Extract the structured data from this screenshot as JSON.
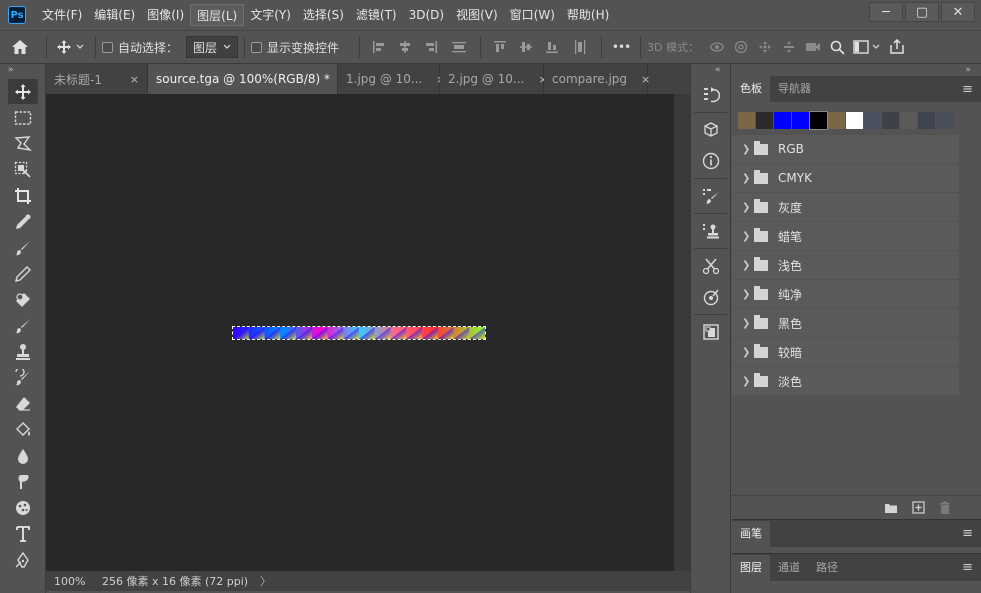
{
  "app": {
    "logo_text": "Ps"
  },
  "menu": {
    "items": [
      "文件(F)",
      "编辑(E)",
      "图像(I)",
      "图层(L)",
      "文字(Y)",
      "选择(S)",
      "滤镜(T)",
      "3D(D)",
      "视图(V)",
      "窗口(W)",
      "帮助(H)"
    ],
    "active_index": 3
  },
  "window_controls": {
    "minimize": "─",
    "restore": "▢",
    "close": "✕"
  },
  "options": {
    "auto_select_label": "自动选择：",
    "auto_select_value": "图层",
    "show_transform_label": "显示变换控件",
    "more": "•••",
    "mode_3d_label": "3D 模式："
  },
  "tabs": [
    {
      "label": "未标题-1",
      "active": false
    },
    {
      "label": "source.tga @ 100%(RGB/8) *",
      "active": true
    },
    {
      "label": "1.jpg @ 10...",
      "active": false
    },
    {
      "label": "2.jpg @ 10...",
      "active": false
    },
    {
      "label": "compare.jpg",
      "active": false
    }
  ],
  "tab_close": "×",
  "status": {
    "zoom": "100%",
    "info": "256 像素 x 16 像素 (72 ppi)",
    "arrow": "〉"
  },
  "tools": [
    "move-tool",
    "marquee-tool",
    "lasso-tool",
    "object-select-tool",
    "crop-tool",
    "eyedropper-tool",
    "healing-brush-tool",
    "brush-tool",
    "clone-stamp-tool",
    "history-brush-tool",
    "eraser-tool",
    "gradient-tool",
    "blur-tool",
    "dodge-tool",
    "sponge-tool",
    "type-tool",
    "pen-tool"
  ],
  "swatches_panel": {
    "tabs": [
      "色板",
      "导航器"
    ],
    "colors": [
      "#7b6646",
      "#2b2b2b",
      "#0000ff",
      "#0000ff",
      "#000000",
      "#7b6646",
      "#ffffff",
      "#4a5060",
      "#3f4048",
      "#5a5a5a",
      "#3f4450",
      "#4a4e5a"
    ],
    "groups": [
      "RGB",
      "CMYK",
      "灰度",
      "蜡笔",
      "浅色",
      "纯净",
      "黑色",
      "较暗",
      "淡色"
    ]
  },
  "brush_panel": {
    "tabs": [
      "画笔"
    ]
  },
  "layers_panel": {
    "tabs": [
      "图层",
      "通道",
      "路径"
    ]
  },
  "menu_icon": "≡"
}
